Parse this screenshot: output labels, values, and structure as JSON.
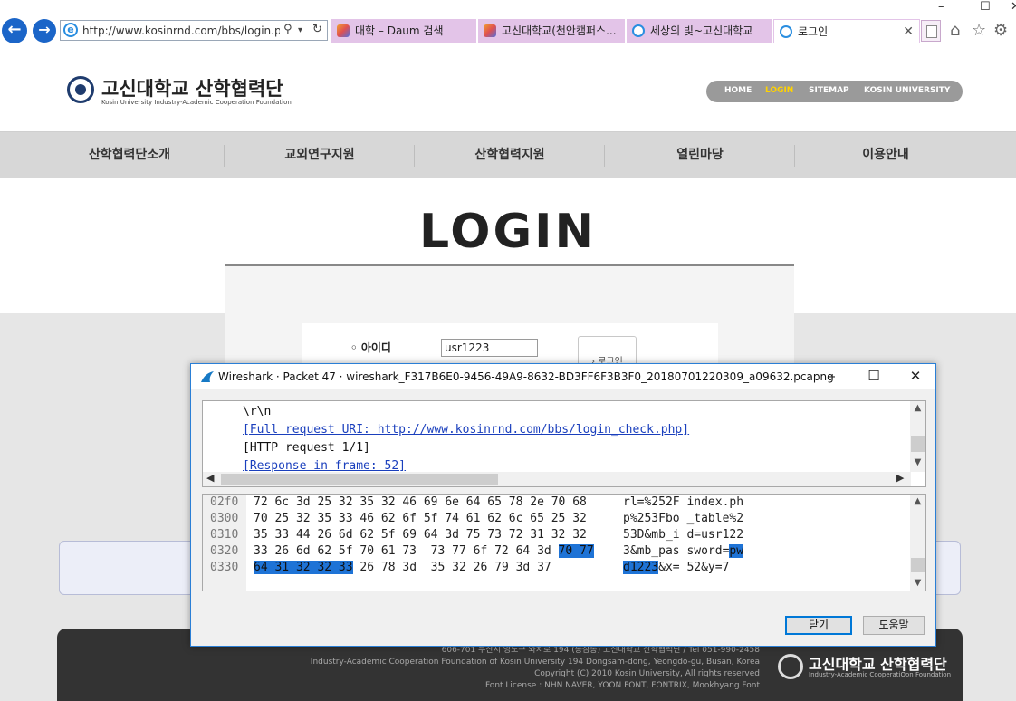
{
  "browser": {
    "address": "http://www.kosinrnd.com/bbs/login.php",
    "tabs": [
      {
        "label": "대학 – Daum 검색"
      },
      {
        "label": "고신대학교(천안캠퍼스..."
      },
      {
        "label": "세상의 빛~고신대학교"
      },
      {
        "label": "로그인"
      }
    ]
  },
  "site": {
    "logo_title": "고신대학교 산학협력단",
    "logo_subtitle": "Kosin University Industry-Academic Cooperation Foundation",
    "util_nav": [
      "HOME",
      "LOGIN",
      "SITEMAP",
      "KOSIN UNIVERSITY"
    ],
    "util_nav_active_color": "#ffd200",
    "gnb": [
      "산학협력단소개",
      "교외연구지원",
      "산학협력지원",
      "열린마당",
      "이용안내"
    ],
    "login_title": "LOGIN",
    "id_label": "◦ 아이디",
    "id_value": "usr1223",
    "login_button": "› 로그인",
    "footer_lines": [
      "606-701 부산시 영도구 와치로 194 (동삼동) 고신대학교 산학협력단 / Tel 051-990-2458",
      "Industry-Academic Cooperation Foundation of Kosin University 194 Dongsam-dong, Yeongdo-gu, Busan, Korea",
      "Copyright (C) 2010 Kosin University, All rights reserved",
      "Font License : NHN NAVER, YOON FONT, FONTRIX, Mookhyang Font"
    ],
    "footer_logo_title": "고신대학교 산학협력단",
    "footer_logo_subtitle": "Industry-Academic CooperatiQon Foundation"
  },
  "wireshark": {
    "title": "Wireshark · Packet 47 · wireshark_F317B6E0-9456-49A9-8632-BD3FF6F3B3F0_20180701220309_a09632.pcapng",
    "detail_lines": [
      {
        "text": "\\r\\n",
        "link": false
      },
      {
        "text": "[Full request URI: http://www.kosinrnd.com/bbs/login_check.php]",
        "link": true
      },
      {
        "text": "[HTTP request 1/1]",
        "link": false
      },
      {
        "text": "[Response in frame: 52]",
        "link": true
      }
    ],
    "hex_rows": [
      {
        "offset": "02f0",
        "hex": "72 6c 3d 25 32 35 32 46  69 6e 64 65 78 2e 70 68",
        "hex_hl": "",
        "hex_tail": "",
        "ascii": "rl=%252F index.ph",
        "ascii_hl": "",
        "ascii_tail": ""
      },
      {
        "offset": "0300",
        "hex": "70 25 32 35 33 46 62 6f  5f 74 61 62 6c 65 25 32",
        "hex_hl": "",
        "hex_tail": "",
        "ascii": "p%253Fbo _table%2",
        "ascii_hl": "",
        "ascii_tail": ""
      },
      {
        "offset": "0310",
        "hex": "35 33 44 26 6d 62 5f 69  64 3d 75 73 72 31 32 32",
        "hex_hl": "",
        "hex_tail": "",
        "ascii": "53D&mb_i d=usr122",
        "ascii_hl": "",
        "ascii_tail": ""
      },
      {
        "offset": "0320",
        "hex": "33 26 6d 62 5f 70 61 73  73 77 6f 72 64 3d ",
        "hex_hl": "70 77",
        "hex_tail": "",
        "ascii": "3&mb_pas sword=",
        "ascii_hl": "pw",
        "ascii_tail": ""
      },
      {
        "offset": "0330",
        "hex": "",
        "hex_hl": "64 31 32 32 33",
        "hex_tail": " 26 78 3d  35 32 26 79 3d 37",
        "ascii": "",
        "ascii_hl": "d1223",
        "ascii_tail": "&x= 52&y=7"
      }
    ],
    "close_button": "닫기",
    "help_button": "도움말",
    "highlight_color": "#1e73d6"
  }
}
